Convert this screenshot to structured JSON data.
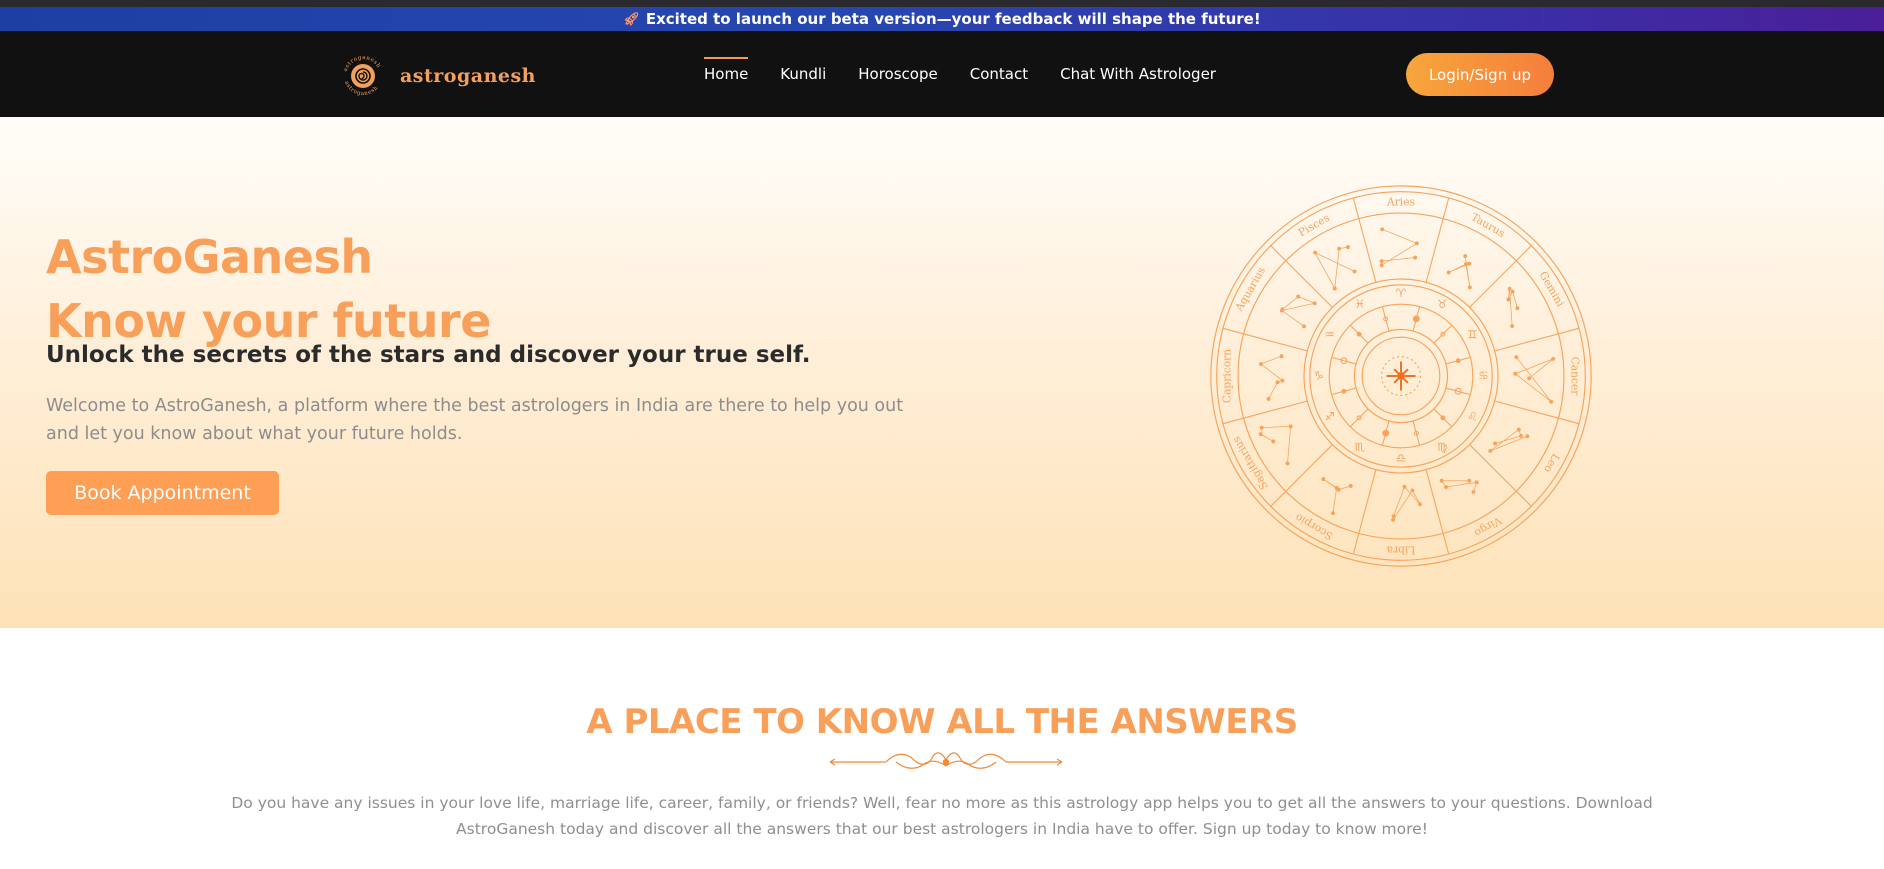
{
  "announcement": {
    "icon": "rocket-icon",
    "text": "Excited to launch our beta version—your feedback will shape the future!"
  },
  "header": {
    "logo_text": "astroganesh",
    "nav": [
      {
        "label": "Home",
        "active": true
      },
      {
        "label": "Kundli",
        "active": false
      },
      {
        "label": "Horoscope",
        "active": false
      },
      {
        "label": "Contact",
        "active": false
      },
      {
        "label": "Chat With Astrologer",
        "active": false
      }
    ],
    "login_label": "Login/Sign up"
  },
  "hero": {
    "title_line1": "AstroGanesh",
    "title_line2": "Know your future",
    "subtitle": "Unlock the secrets of the stars and discover your true self.",
    "description": "Welcome to AstroGanesh, a platform where the best astrologers in India are there to help you out and let you know about what your future holds.",
    "cta_label": "Book Appointment",
    "zodiac_signs": [
      "Aries",
      "Taurus",
      "Gemini",
      "Cancer",
      "Leo",
      "Virgo",
      "Libra",
      "Scorpio",
      "Sagittarius",
      "Capricorn",
      "Aquarius",
      "Pisces"
    ]
  },
  "answers": {
    "title": "A PLACE TO KNOW ALL THE ANSWERS",
    "text": "Do you have any issues in your love life, marriage life, career, family, or friends? Well, fear no more as this astrology app helps you to get all the answers to your questions. Download AstroGanesh today and discover all the answers that our best astrologers in India have to offer. Sign up today to know more!"
  },
  "colors": {
    "accent": "#f8a05a",
    "button": "#ff9f56",
    "nav_bg": "#111111",
    "banner_start": "#1d3fa3",
    "banner_end": "#4a1f99"
  }
}
